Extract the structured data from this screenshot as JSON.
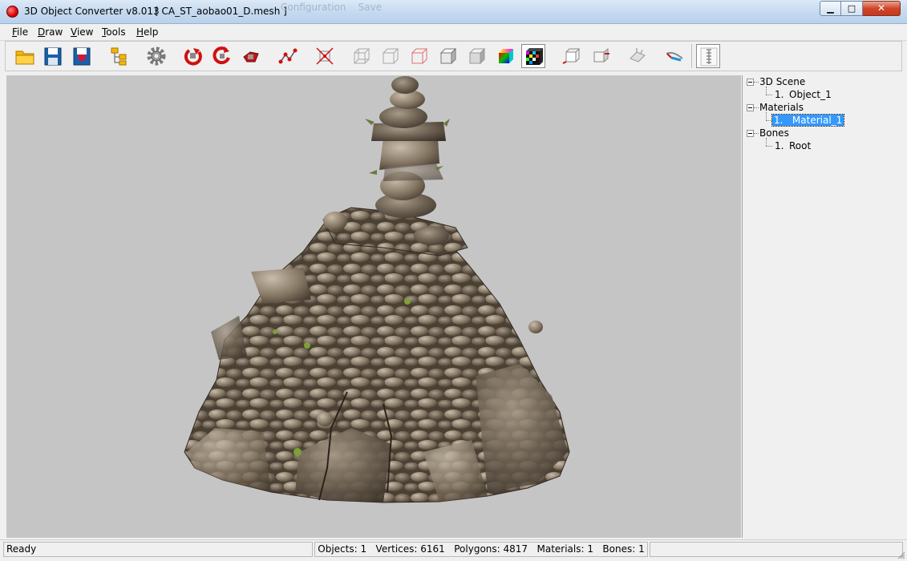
{
  "window": {
    "title": "3D Object Converter v8.013",
    "file": "[ CA_ST_aobao01_D.mesh ]",
    "background_title_ghost": "Configuration    Save",
    "buttons": {
      "minimize": "▁",
      "maximize": "□",
      "close": "✕"
    }
  },
  "menu": [
    {
      "label": "File",
      "accel": "F",
      "rest": "ile"
    },
    {
      "label": "Draw",
      "accel": "D",
      "rest": "raw"
    },
    {
      "label": "View",
      "accel": "V",
      "rest": "iew"
    },
    {
      "label": "Tools",
      "accel": "T",
      "rest": "ools"
    },
    {
      "label": "Help",
      "accel": "H",
      "rest": "elp"
    }
  ],
  "toolbar": [
    {
      "name": "open-file-button",
      "icon": "folder-icon"
    },
    {
      "name": "save-button",
      "icon": "floppy-disk-icon"
    },
    {
      "name": "save-as-button",
      "icon": "floppy-heart-icon"
    },
    {
      "name": "hierarchy-button",
      "icon": "tree-structure-icon"
    },
    {
      "name": "settings-button",
      "icon": "gear-icon"
    },
    {
      "name": "rotate-y-button",
      "icon": "rotate-y-icon"
    },
    {
      "name": "rotate-x-button",
      "icon": "rotate-x-icon"
    },
    {
      "name": "rotate-z-button",
      "icon": "rotate-z-icon"
    },
    {
      "name": "vertices-button",
      "icon": "vertex-path-icon"
    },
    {
      "name": "axes-button",
      "icon": "axes-icon"
    },
    {
      "name": "wireframe-button",
      "icon": "wireframe-cube-icon"
    },
    {
      "name": "wireframe-hidden-button",
      "icon": "wireframe-hidden-cube-icon"
    },
    {
      "name": "wireframe-color-button",
      "icon": "wireframe-red-cube-icon"
    },
    {
      "name": "flat-shaded-button",
      "icon": "flat-cube-icon"
    },
    {
      "name": "smooth-shaded-button",
      "icon": "smooth-cube-icon"
    },
    {
      "name": "color-shaded-button",
      "icon": "color-cube-icon"
    },
    {
      "name": "textured-button",
      "icon": "textured-cube-icon"
    },
    {
      "name": "front-view-button",
      "icon": "front-view-icon"
    },
    {
      "name": "side-view-button",
      "icon": "side-view-icon"
    },
    {
      "name": "normals-button",
      "icon": "normals-icon"
    },
    {
      "name": "uv-button",
      "icon": "uv-pencil-icon"
    },
    {
      "name": "skeleton-button",
      "icon": "skeleton-icon"
    }
  ],
  "tree": {
    "scene": {
      "label": "3D Scene",
      "children": [
        {
          "index": "1.",
          "label": "Object_1"
        }
      ]
    },
    "materials": {
      "label": "Materials",
      "children": [
        {
          "index": "1.",
          "label": "Material_1"
        }
      ]
    },
    "bones": {
      "label": "Bones",
      "children": [
        {
          "index": "1.",
          "label": "Root"
        }
      ]
    }
  },
  "status": {
    "state": "Ready",
    "stats": "Objects: 1   Vertices: 6161   Polygons: 4817   Materials: 1   Bones: 1"
  },
  "colors": {
    "viewport_bg": "#c5c5c5",
    "selection": "#3399ff",
    "close_button": "#c9442a"
  }
}
